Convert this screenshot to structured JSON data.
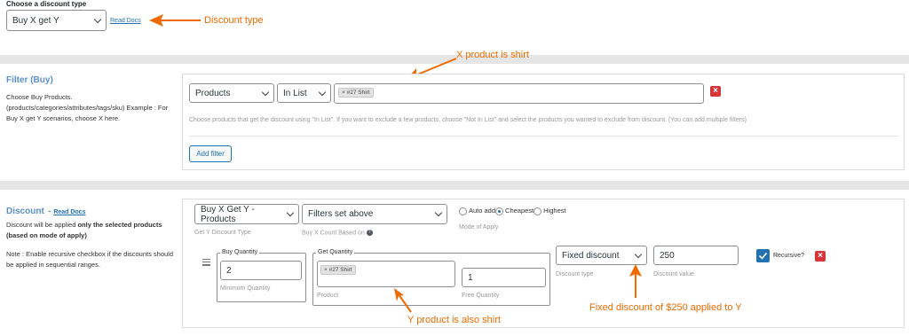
{
  "discount_type": {
    "heading": "Choose a discount type",
    "selected": "Buy X get Y",
    "read_docs": "Read Docs",
    "annotation": "Discount type"
  },
  "filter": {
    "title": "Filter (Buy)",
    "desc": "Choose Buy Products. (products/categories/attributes/tags/sku) Example : For Buy X get Y scenarios, choose X here.",
    "type_selected": "Products",
    "condition_selected": "In List",
    "chip": "× #27 Shirt",
    "hint": "Choose products that get the discount using \"In List\". If you want to exclude a few products, choose \"Not In List\" and select the products you wanted to exclude from discount. (You can add multiple filters)",
    "add_filter": "Add filter",
    "annotation": "X product is shirt"
  },
  "discount": {
    "title": "Discount",
    "read_docs": "Read Docs",
    "desc_pre": "Discount will be applied ",
    "desc_bold": "only the selected products (based on mode of apply)",
    "note": "Note : Enable recursive checkbox if the discounts should be applied in sequential ranges.",
    "get_y_selected": "Buy X Get Y - Products",
    "get_y_label": "Get Y Discount Type",
    "count_selected": "Filters set above",
    "count_label": "Buy X Count Based on",
    "mode_options": [
      "Auto add",
      "Cheapest",
      "Highest"
    ],
    "mode_label": "Mode of Apply",
    "buy_qty_legend": "Buy Quantity",
    "buy_qty_value": "2",
    "buy_qty_label": "Minimum Quantity",
    "get_qty_legend": "Get Quantity",
    "product_chip": "× #27 Shirt",
    "product_label": "Product",
    "free_qty_value": "1",
    "free_qty_label": "Free Quantity",
    "dtype_selected": "Fixed discount",
    "dtype_label": "Discount type",
    "dvalue": "250",
    "dvalue_label": "Discount value",
    "recursive_label": "Recursive?",
    "annotation_y": "Y product is also shirt",
    "annotation_fixed": "Fixed discount of $250 applied to Y"
  },
  "colors": {
    "accent": "#2271b1",
    "annotation": "#f06a00",
    "danger": "#d63638",
    "band": "#e5e5e5"
  }
}
